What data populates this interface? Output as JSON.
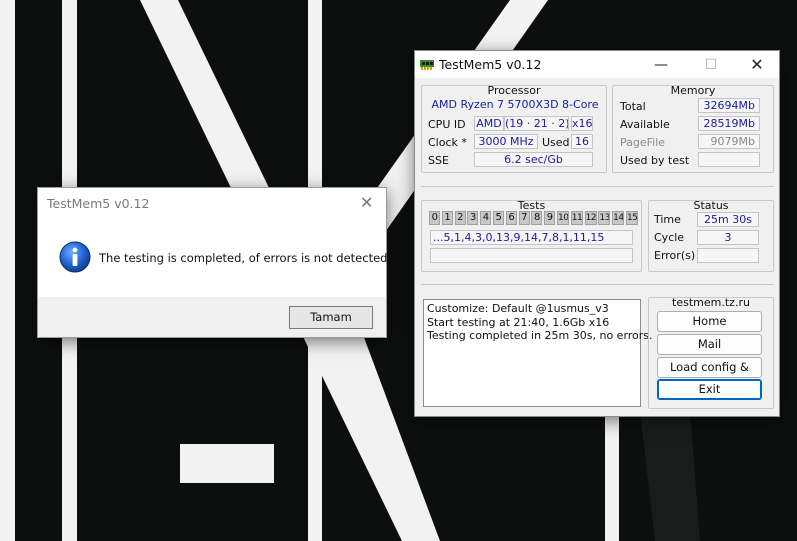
{
  "main_window": {
    "title": "TestMem5 v0.12",
    "processor": {
      "group_title": "Processor",
      "name": "AMD Ryzen 7 5700X3D 8-Core",
      "cpu_id_label": "CPU ID",
      "cpu_id_vendor": "AMD",
      "cpu_id_value": "(19 · 21 · 2)",
      "cpu_threads": "x16",
      "clock_label": "Clock *",
      "clock_value": "3000 MHz",
      "used_label": "Used",
      "used_value": "16",
      "sse_label": "SSE",
      "sse_value": "6.2 sec/Gb"
    },
    "memory": {
      "group_title": "Memory",
      "total_label": "Total",
      "total_value": "32694Mb",
      "available_label": "Available",
      "available_value": "28519Mb",
      "pagefile_label": "PageFile",
      "pagefile_value": "9079Mb",
      "used_by_test_label": "Used by test",
      "used_by_test_value": ""
    },
    "tests": {
      "group_title": "Tests",
      "tiles": [
        "0",
        "1",
        "2",
        "3",
        "4",
        "5",
        "6",
        "7",
        "8",
        "9",
        "10",
        "11",
        "12",
        "13",
        "14",
        "15"
      ],
      "sequence": "...5,1,4,3,0,13,9,14,7,8,1,11,15",
      "progress_text": ""
    },
    "status": {
      "group_title": "Status",
      "time_label": "Time",
      "time_value": "25m 30s",
      "cycle_label": "Cycle",
      "cycle_value": "3",
      "errors_label": "Error(s)",
      "errors_value": ""
    },
    "log": [
      "Customize: Default @1usmus_v3",
      "Start testing at 21:40, 1.6Gb x16",
      "Testing completed in 25m 30s, no errors."
    ],
    "links": {
      "site": "testmem.tz.ru",
      "home_label": "Home",
      "mail_label": "Mail",
      "load_config_label": "Load config & exit",
      "exit_label": "Exit"
    }
  },
  "message_box": {
    "title": "TestMem5 v0.12",
    "text": "The testing is completed, of errors is not detected.",
    "ok_label": "Tamam",
    "icon": "info-icon"
  },
  "colors": {
    "value_text": "#1a1aa0",
    "focus_border": "#0067c0"
  }
}
